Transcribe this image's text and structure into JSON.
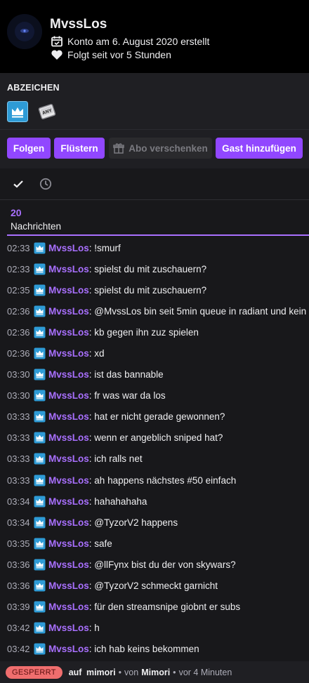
{
  "colors": {
    "accent": "#9147ff",
    "username": "#a970ff",
    "banned_pill": "#f06e6e",
    "sub_badge": "#2e9bd6"
  },
  "profile": {
    "username": "MvssLos",
    "created": "Konto am 6. August 2020 erstellt",
    "following": "Folgt seit vor 5 Stunden",
    "created_icon": "calendar-icon",
    "following_icon": "heart-icon"
  },
  "badges": {
    "title": "ABZEICHEN",
    "items": [
      {
        "icon": "subscriber-crown-badge"
      },
      {
        "icon": "prime-gaming-badge"
      }
    ]
  },
  "actions": {
    "follow": "Folgen",
    "whisper": "Flüstern",
    "gift": "Abo verschenken",
    "add_guest": "Gast hinzufügen"
  },
  "tabs": [
    {
      "icon": "checkmark-icon"
    },
    {
      "icon": "clock-icon"
    }
  ],
  "summary": {
    "count": "20",
    "label": "Nachrichten"
  },
  "messages": [
    {
      "time": "02:33",
      "user": "MvssLos",
      "sep": ": ",
      "text": "!smurf"
    },
    {
      "time": "02:33",
      "user": "MvssLos",
      "sep": ": ",
      "text": "spielst du mit zuschauern?"
    },
    {
      "time": "02:35",
      "user": "MvssLos",
      "sep": ": ",
      "text": "spielst du mit zuschauern?"
    },
    {
      "time": "02:36",
      "user": "MvssLos",
      "sep": ": ",
      "text": "@MvssLos bin seit 5min queue in radiant und kein"
    },
    {
      "time": "02:36",
      "user": "MvssLos",
      "sep": ": ",
      "text": "kb gegen ihn zuz spielen"
    },
    {
      "time": "02:36",
      "user": "MvssLos",
      "sep": ": ",
      "text": "xd"
    },
    {
      "time": "03:30",
      "user": "MvssLos",
      "sep": ": ",
      "text": "ist das bannable"
    },
    {
      "time": "03:30",
      "user": "MvssLos",
      "sep": ": ",
      "text": "fr was war da los"
    },
    {
      "time": "03:33",
      "user": "MvssLos",
      "sep": ": ",
      "text": "hat er nicht gerade gewonnen?"
    },
    {
      "time": "03:33",
      "user": "MvssLos",
      "sep": ": ",
      "text": "wenn er angeblich sniped hat?"
    },
    {
      "time": "03:33",
      "user": "MvssLos",
      "sep": ": ",
      "text": "ich ralls net"
    },
    {
      "time": "03:33",
      "user": "MvssLos",
      "sep": ": ",
      "text": "ah happens nächstes #50 einfach"
    },
    {
      "time": "03:34",
      "user": "MvssLos",
      "sep": ": ",
      "text": "hahahahaha"
    },
    {
      "time": "03:34",
      "user": "MvssLos",
      "sep": ": ",
      "text": "@TyzorV2 happens"
    },
    {
      "time": "03:35",
      "user": "MvssLos",
      "sep": ": ",
      "text": "safe"
    },
    {
      "time": "03:36",
      "user": "MvssLos",
      "sep": ": ",
      "text": "@llFynx bist du der von skywars?"
    },
    {
      "time": "03:36",
      "user": "MvssLos",
      "sep": ": ",
      "text": "@TyzorV2 schmeckt garnicht"
    },
    {
      "time": "03:39",
      "user": "MvssLos",
      "sep": ": ",
      "text": "für den streamsnipe giobnt er subs"
    },
    {
      "time": "03:42",
      "user": "MvssLos",
      "sep": ": ",
      "text": "h"
    },
    {
      "time": "03:42",
      "user": "MvssLos",
      "sep": ": ",
      "text": "ich hab keins bekommen"
    }
  ],
  "footer": {
    "status": "GESPERRT",
    "on": "auf",
    "channel": "mimori",
    "dot1": "•",
    "by": "von",
    "moderator": "Mimori",
    "dot2": "•",
    "when": "vor 4 Minuten"
  }
}
